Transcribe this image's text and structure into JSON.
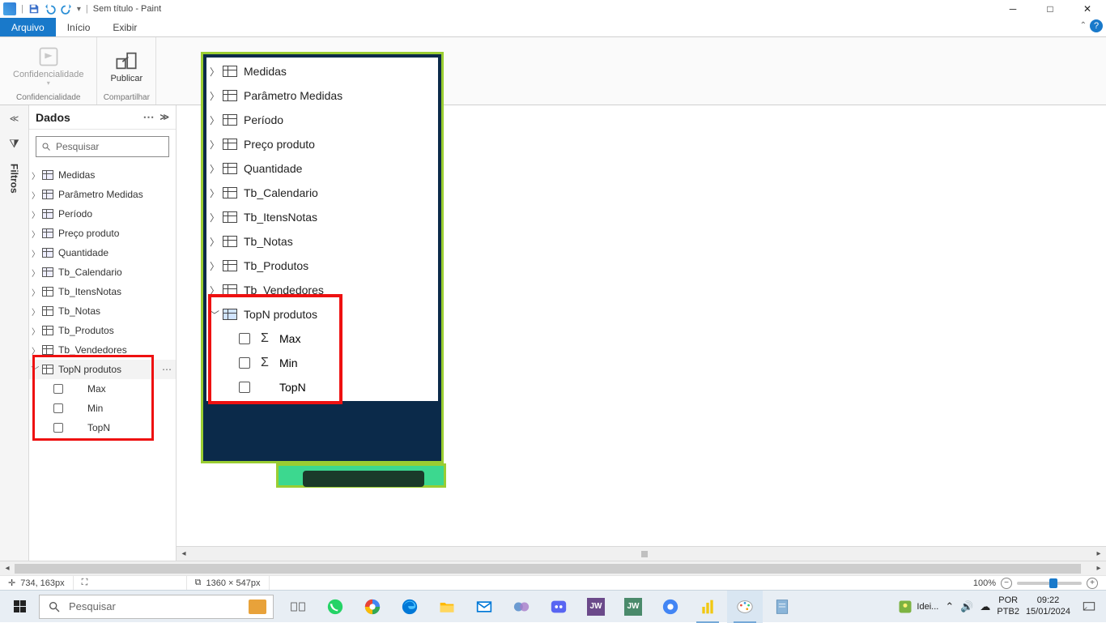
{
  "titlebar": {
    "title": "Sem título - Paint"
  },
  "menu": {
    "arquivo": "Arquivo",
    "inicio": "Início",
    "exibir": "Exibir"
  },
  "ribbon": {
    "confidencialidade_btn": "Confidencialidade",
    "confidencialidade_group": "Confidencialidade",
    "publicar_btn": "Publicar",
    "compartilhar_group": "Compartilhar"
  },
  "filtros_rail": "Filtros",
  "dados": {
    "title": "Dados",
    "search_placeholder": "Pesquisar",
    "items": [
      {
        "label": "Medidas"
      },
      {
        "label": "Parâmetro Medidas"
      },
      {
        "label": "Período"
      },
      {
        "label": "Preço produto"
      },
      {
        "label": "Quantidade"
      },
      {
        "label": "Tb_Calendario"
      },
      {
        "label": "Tb_ItensNotas"
      },
      {
        "label": "Tb_Notas"
      },
      {
        "label": "Tb_Produtos"
      },
      {
        "label": "Tb_Vendedores"
      }
    ],
    "topn": {
      "label": "TopN produtos",
      "children": [
        "Max",
        "Min",
        "TopN"
      ]
    }
  },
  "embedded": {
    "items": [
      {
        "label": "Medidas"
      },
      {
        "label": "Parâmetro Medidas"
      },
      {
        "label": "Período"
      },
      {
        "label": "Preço produto"
      },
      {
        "label": "Quantidade"
      },
      {
        "label": "Tb_Calendario"
      },
      {
        "label": "Tb_ItensNotas"
      },
      {
        "label": "Tb_Notas"
      },
      {
        "label": "Tb_Produtos"
      },
      {
        "label": "Tb_Vendedores"
      }
    ],
    "topn": {
      "label": "TopN produtos",
      "children": [
        "Max",
        "Min",
        "TopN"
      ]
    }
  },
  "status": {
    "cursor": "734, 163px",
    "canvas_size": "1360 × 547px",
    "zoom": "100%"
  },
  "taskbar": {
    "search_placeholder": "Pesquisar",
    "weather_label": "Idei...",
    "lang1": "POR",
    "lang2": "PTB2",
    "time": "09:22",
    "date": "15/01/2024"
  }
}
